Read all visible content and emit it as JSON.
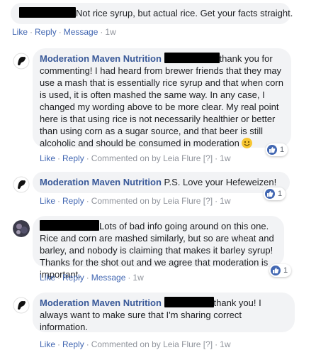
{
  "comments": [
    {
      "text": "Not rice syrup, but actual rice. Get your facts straight.",
      "actions": {
        "like": "Like",
        "reply": "Reply",
        "message": "Message",
        "time": "1w"
      }
    },
    {
      "author": "Moderation Maven Nutrition",
      "text_line1": "thank you for",
      "text_body": "commenting! I had heard from brewer friends that they may use a mash that is essentially rice syrup and that when corn is used, it is often mashed the same way. In any case, I changed my wording above to be more clear. My real point here is that using rice is not necessarily healthier or better than using corn as a sugar source, and that beer is still alcoholic and should be consumed in moderation",
      "actions": {
        "like": "Like",
        "reply": "Reply",
        "commented": "Commented on by Leia Flure",
        "flag": "[?]",
        "time": "1w"
      },
      "reactions": "1"
    },
    {
      "author": "Moderation Maven Nutrition",
      "text": "P.S. Love your Hefeweizen!",
      "actions": {
        "like": "Like",
        "reply": "Reply",
        "commented": "Commented on by Leia Flure",
        "flag": "[?]",
        "time": "1w"
      },
      "reactions": "1"
    },
    {
      "text_line1": "Lots of bad info going around on this one. Rice",
      "text_body": "and corn are mashed similarly, but so are wheat and barley, and nobody is claiming that makes it barley syrup! Thanks for the shot out and we agree that moderation is important.",
      "actions": {
        "like": "Like",
        "reply": "Reply",
        "message": "Message",
        "time": "1w"
      },
      "reactions": "1"
    },
    {
      "author": "Moderation Maven Nutrition",
      "text_line1": "thank you! I",
      "text_body": "always want to make sure that I'm sharing correct information.",
      "actions": {
        "like": "Like",
        "reply": "Reply",
        "commented": "Commented on by Leia Flure",
        "flag": "[?]",
        "time": "1w"
      }
    }
  ],
  "colors": {
    "link": "#4267b2",
    "author": "#385898",
    "bubble": "#f2f3f5",
    "muted": "#90949c"
  }
}
